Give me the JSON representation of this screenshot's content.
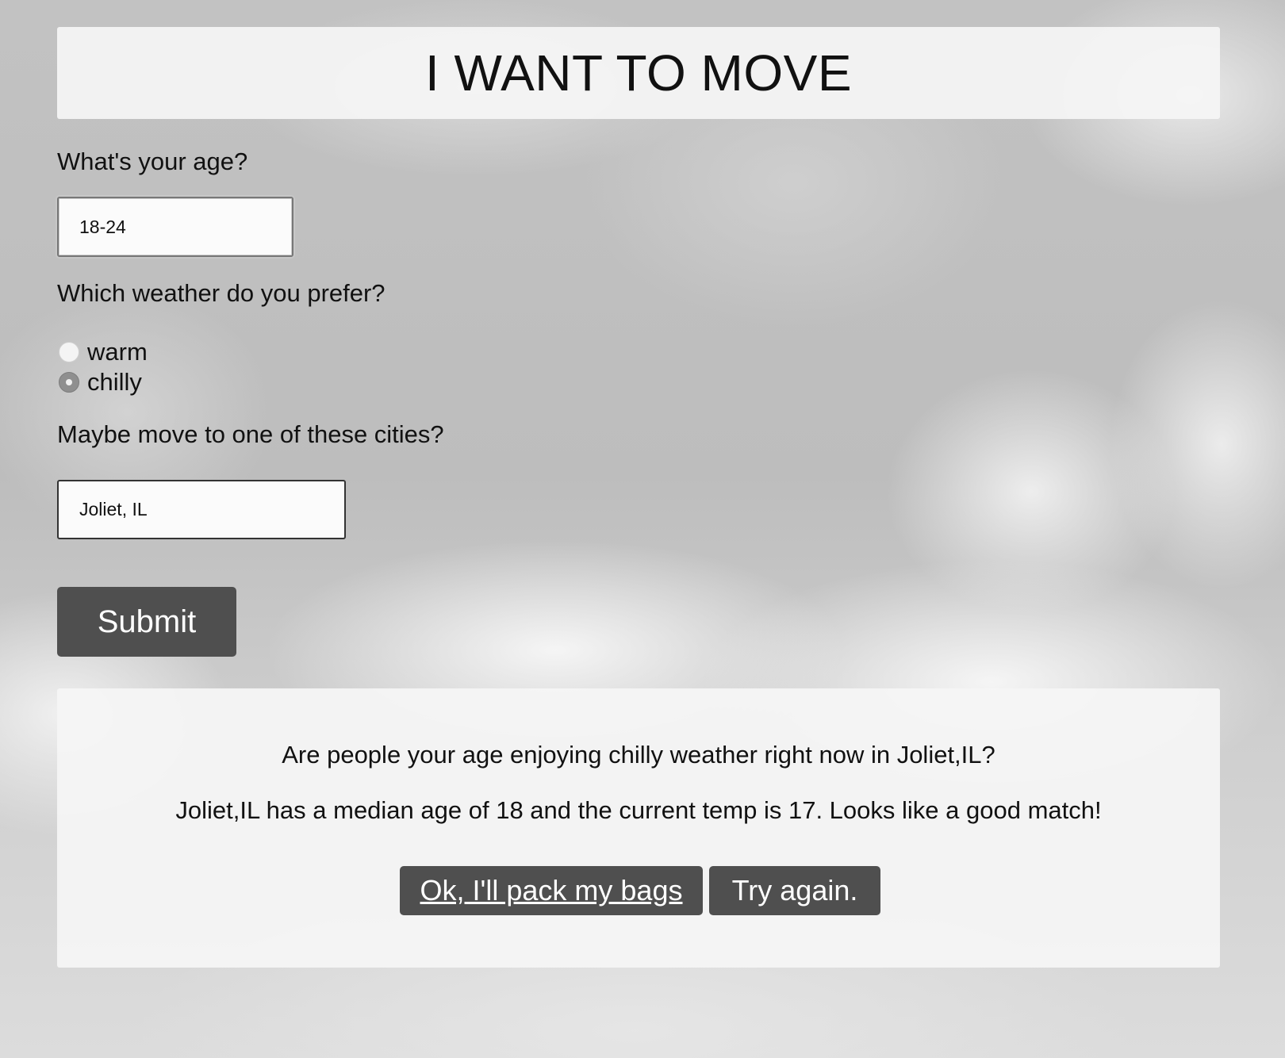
{
  "header": {
    "title": "I WANT TO MOVE"
  },
  "form": {
    "age_label": "What's your age?",
    "age_value": "18-24",
    "weather_label": "Which weather do you prefer?",
    "weather_options": [
      {
        "label": "warm",
        "checked": false
      },
      {
        "label": "chilly",
        "checked": true
      }
    ],
    "city_label": "Maybe move to one of these cities?",
    "city_value": "Joliet, IL",
    "submit_label": "Submit"
  },
  "result": {
    "question": "Are people your age enjoying chilly weather right now in Joliet,IL?",
    "answer": "Joliet,IL has a median age of 18 and the current temp is 17. Looks like a good match!",
    "accept_label": "Ok, I'll pack my bags",
    "retry_label": "Try again."
  },
  "colors": {
    "button_bg": "#4f4f4f",
    "panel_bg": "#f5f5f5"
  }
}
